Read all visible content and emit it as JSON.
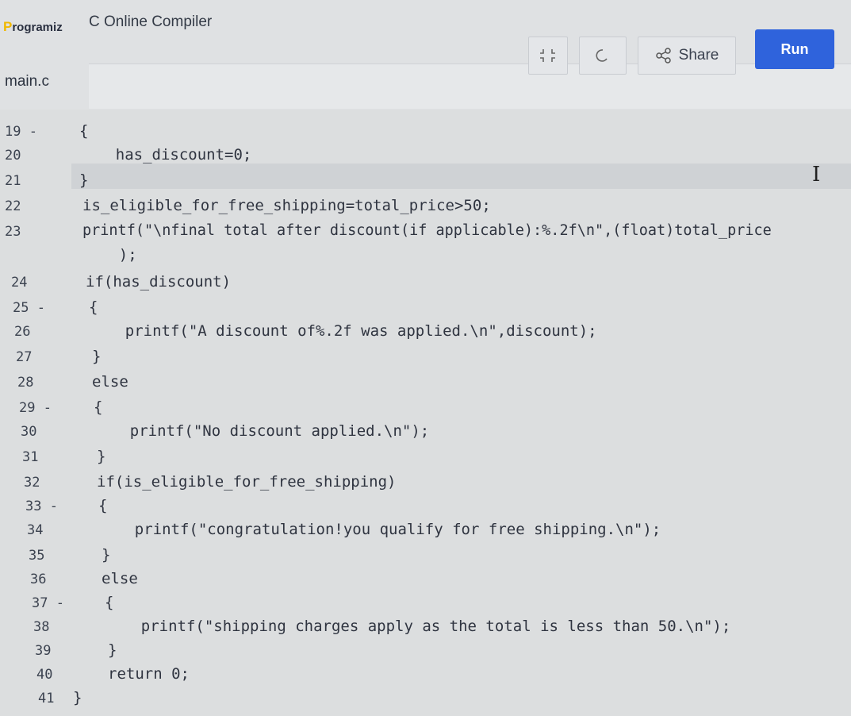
{
  "header": {
    "logo_first": "P",
    "logo_rest": "rogramiz",
    "app_title": "C Online Compiler"
  },
  "file": {
    "name": "main.c"
  },
  "toolbar": {
    "fullscreen_icon": "fullscreen-icon",
    "theme_icon": "theme-toggle-icon",
    "share_icon": "share-icon",
    "share_label": "Share",
    "run_label": "Run"
  },
  "editor": {
    "cursor_glyph": "I",
    "lines": [
      {
        "num": "19 -",
        "code": "{"
      },
      {
        "num": "20",
        "code": "    has_discount=0;"
      },
      {
        "num": "21",
        "code": "}"
      },
      {
        "num": "22",
        "code": "is_eligible_for_free_shipping=total_price>50;"
      },
      {
        "num": "23",
        "code": "printf(\"\\nfinal total after discount(if applicable):%.2f\\n\",(float)total_price"
      },
      {
        "num": "",
        "code": "    );"
      },
      {
        "num": "24",
        "code": "if(has_discount)"
      },
      {
        "num": "25 -",
        "code": "{"
      },
      {
        "num": "26",
        "code": "    printf(\"A discount of%.2f was applied.\\n\",discount);"
      },
      {
        "num": "27",
        "code": "}"
      },
      {
        "num": "28",
        "code": "else"
      },
      {
        "num": "29 -",
        "code": "{"
      },
      {
        "num": "30",
        "code": "    printf(\"No discount applied.\\n\");"
      },
      {
        "num": "31",
        "code": "}"
      },
      {
        "num": "32",
        "code": "if(is_eligible_for_free_shipping)"
      },
      {
        "num": "33 -",
        "code": "{"
      },
      {
        "num": "34",
        "code": "    printf(\"congratulation!you qualify for free shipping.\\n\");"
      },
      {
        "num": "35",
        "code": "}"
      },
      {
        "num": "36",
        "code": "else"
      },
      {
        "num": "37 -",
        "code": "{"
      },
      {
        "num": "38",
        "code": "    printf(\"shipping charges apply as the total is less than 50.\\n\");"
      },
      {
        "num": "39",
        "code": "}"
      },
      {
        "num": "40",
        "code": "return 0;"
      },
      {
        "num": "41",
        "code": "}"
      }
    ]
  }
}
